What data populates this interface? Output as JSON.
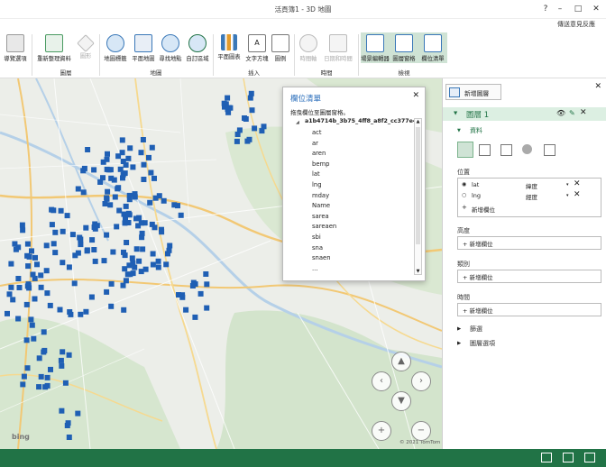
{
  "window": {
    "title": "活頁簿1 - 3D 地圖",
    "feedback": "傳送意見反應",
    "help": "?"
  },
  "ribbon": {
    "buttons": [
      {
        "label": "導覽選項"
      },
      {
        "label": "重新整理資料"
      },
      {
        "label": "圖形"
      },
      {
        "label": "地圖標籤"
      },
      {
        "label": "平面地圖"
      },
      {
        "label": "尋找地點"
      },
      {
        "label": "自訂區域"
      },
      {
        "label": "平面圖表"
      },
      {
        "label": "文字方塊"
      },
      {
        "label": "圖例"
      },
      {
        "label": "時間軸"
      },
      {
        "label": "日期和時間"
      },
      {
        "label": "場景編輯器"
      },
      {
        "label": "圖層窗格"
      },
      {
        "label": "欄位清單"
      }
    ],
    "groups": [
      "圖層",
      "地圖",
      "插入",
      "時間",
      "檢視"
    ]
  },
  "fieldlist": {
    "title": "欄位清單",
    "hint": "拖曳欄位至圖層窗格。",
    "table": "a1b4714b_3b75_4ff8_a8f2_cc377e4ea",
    "fields": [
      "act",
      "ar",
      "aren",
      "bemp",
      "lat",
      "lng",
      "mday",
      "Name",
      "sarea",
      "sareaen",
      "sbi",
      "sna",
      "snaen",
      "..."
    ]
  },
  "map": {
    "attribution": "© 2021 TomTom",
    "logo": "bing",
    "zoom_in": "+",
    "zoom_out": "−"
  },
  "pane": {
    "new_layer": "新增圖層",
    "layer_name": "圖層 1",
    "data_heading": "資料",
    "location_heading": "位置",
    "location_fields": [
      {
        "name": "lat",
        "type": "緯度"
      },
      {
        "name": "lng",
        "type": "經度"
      }
    ],
    "add_field": "新增欄位",
    "height_heading": "高度",
    "category_heading": "類別",
    "time_heading": "時間",
    "filter_heading": "篩選",
    "layer_options_heading": "圖層選項"
  },
  "colors": {
    "accent": "#217346",
    "point": "#1f5fb4",
    "layer_header": "#dcefe2"
  }
}
